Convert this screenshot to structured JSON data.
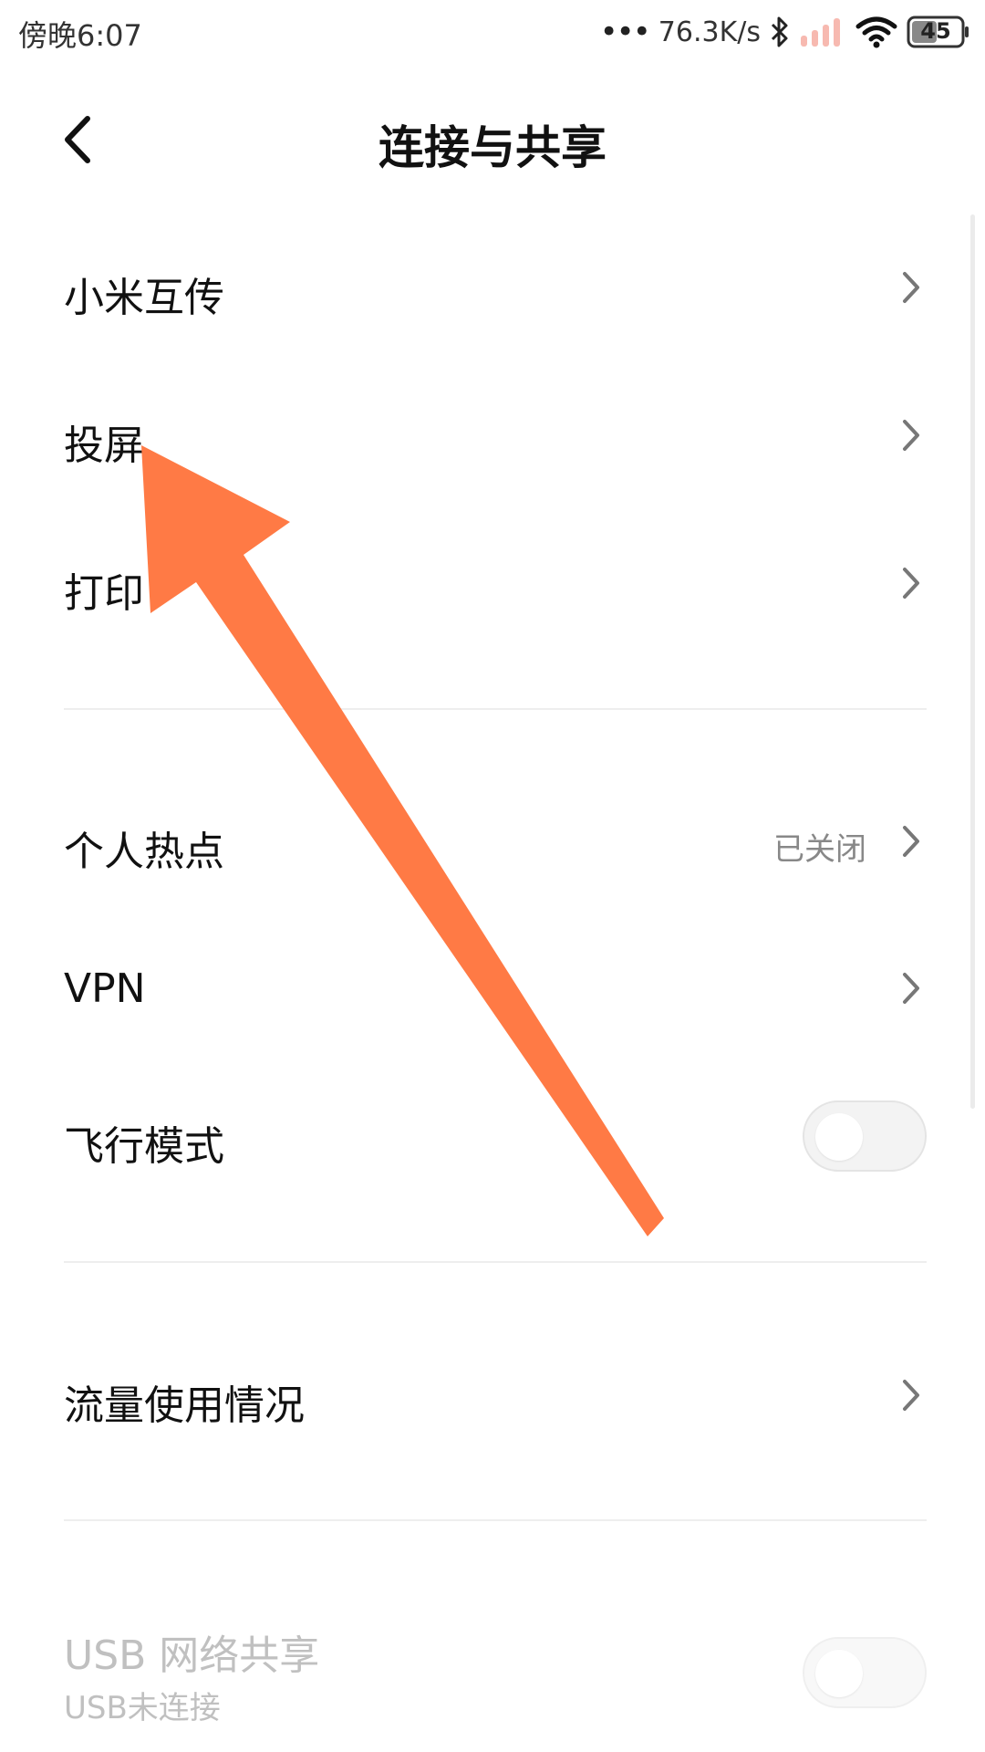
{
  "status_bar": {
    "time": "傍晚6:07",
    "network_speed": "76.3K/s",
    "battery_level": "45",
    "icons": [
      "more-dots-icon",
      "bluetooth-icon",
      "signal-icon",
      "wifi-icon",
      "battery-icon"
    ]
  },
  "header": {
    "title": "连接与共享",
    "back_icon": "chevron-left-icon"
  },
  "items": {
    "mi_share": {
      "label": "小米互传"
    },
    "cast": {
      "label": "投屏"
    },
    "print": {
      "label": "打印"
    },
    "hotspot": {
      "label": "个人热点",
      "value": "已关闭"
    },
    "vpn": {
      "label": "VPN"
    },
    "airplane": {
      "label": "飞行模式",
      "toggle_on": false
    },
    "data_usage": {
      "label": "流量使用情况"
    },
    "usb_tethering": {
      "label": "USB 网络共享",
      "sub": "USB未连接",
      "toggle_on": false,
      "enabled": false
    }
  },
  "colors": {
    "annotation_arrow": "#ff7a45",
    "text_primary": "#111111",
    "text_secondary": "#888888",
    "text_disabled": "#c0c0c0",
    "signal_dim": "#f7b9b0"
  }
}
